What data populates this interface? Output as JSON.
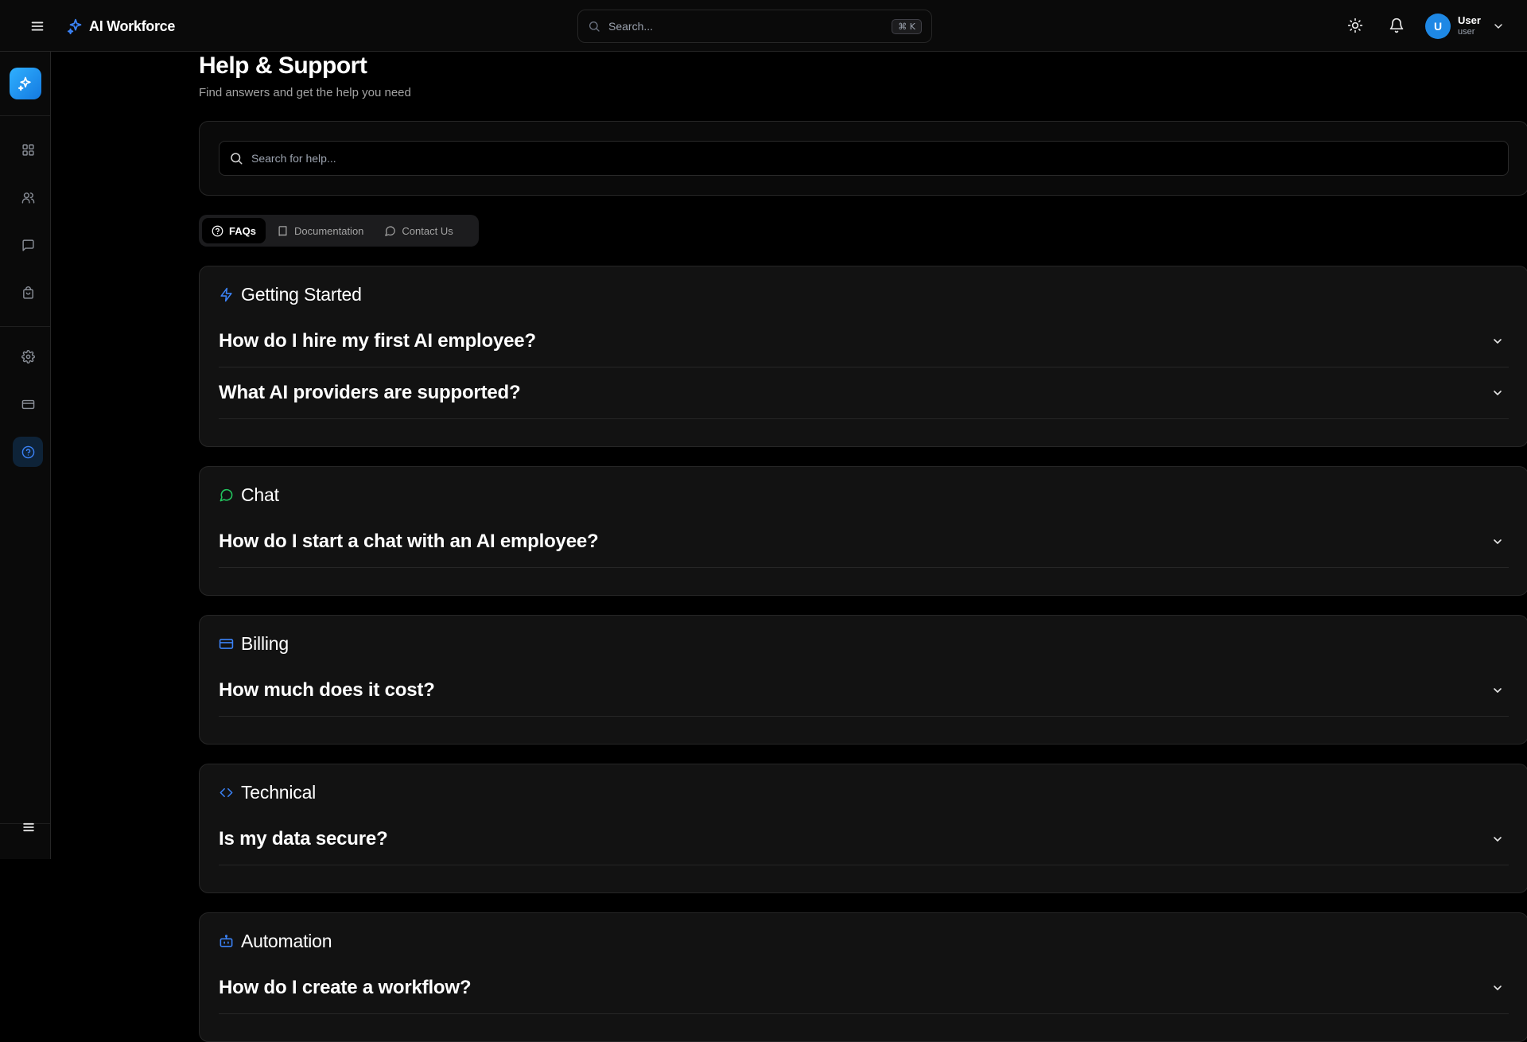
{
  "app": {
    "brand": "AI Workforce",
    "search_placeholder": "Search...",
    "search_shortcut": "⌘ K",
    "accent_color": "#1e88e5"
  },
  "user": {
    "avatar_initial": "U",
    "name": "User",
    "role": "user"
  },
  "sidebar": {
    "items": [
      {
        "icon": "dashboard-grid-icon",
        "active": false
      },
      {
        "icon": "users-icon",
        "active": false
      },
      {
        "icon": "chat-icon",
        "active": false
      },
      {
        "icon": "shopping-bag-icon",
        "active": false
      },
      {
        "icon": "gear-icon",
        "active": false
      },
      {
        "icon": "credit-card-icon",
        "active": false
      },
      {
        "icon": "help-circle-icon",
        "active": true
      }
    ]
  },
  "page": {
    "title": "Help & Support",
    "subtitle": "Find answers and get the help you need",
    "search_placeholder": "Search for help..."
  },
  "tabs": [
    {
      "label": "FAQs",
      "icon": "help-circle-icon",
      "active": true
    },
    {
      "label": "Documentation",
      "icon": "book-icon",
      "active": false
    },
    {
      "label": "Contact Us",
      "icon": "message-circle-icon",
      "active": false
    }
  ],
  "sections": [
    {
      "title": "Getting Started",
      "icon": "lightning-icon",
      "icon_color": "#3b82f6",
      "questions": [
        "How do I hire my first AI employee?",
        "What AI providers are supported?"
      ]
    },
    {
      "title": "Chat",
      "icon": "message-circle-icon",
      "icon_color": "#22c55e",
      "questions": [
        "How do I start a chat with an AI employee?"
      ]
    },
    {
      "title": "Billing",
      "icon": "credit-card-icon",
      "icon_color": "#3b82f6",
      "questions": [
        "How much does it cost?"
      ]
    },
    {
      "title": "Technical",
      "icon": "code-icon",
      "icon_color": "#3b82f6",
      "questions": [
        "Is my data secure?"
      ]
    },
    {
      "title": "Automation",
      "icon": "robot-icon",
      "icon_color": "#3b82f6",
      "questions": [
        "How do I create a workflow?"
      ]
    }
  ]
}
